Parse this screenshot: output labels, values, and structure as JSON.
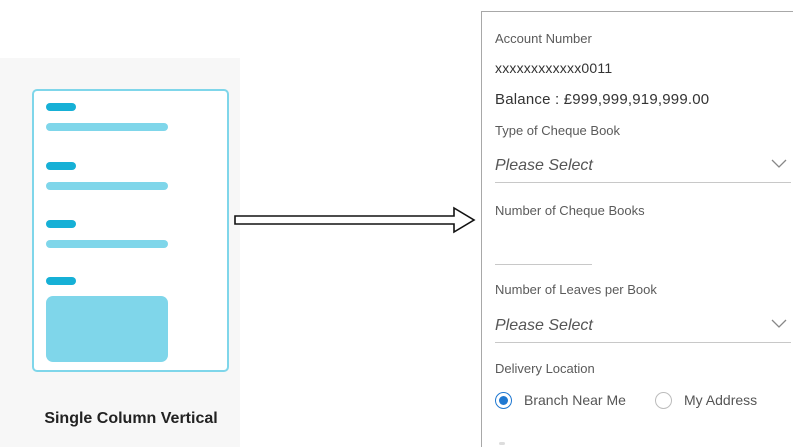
{
  "illustration": {
    "caption": "Single Column Vertical"
  },
  "form": {
    "account_number_label": "Account Number",
    "account_number_value": "xxxxxxxxxxxx0011",
    "balance_text": "Balance : £999,999,919,999.00",
    "cheque_book_type": {
      "label": "Type of Cheque Book",
      "value": "Please Select"
    },
    "cheque_book_count": {
      "label": "Number of Cheque Books",
      "value": ""
    },
    "leaves_per_book": {
      "label": "Number of Leaves per Book",
      "value": "Please Select"
    },
    "delivery_location": {
      "label": "Delivery Location",
      "options": [
        {
          "label": "Branch Near Me",
          "selected": true
        },
        {
          "label": "My Address",
          "selected": false
        }
      ]
    }
  },
  "colors": {
    "wire_accent": "#16b0d6",
    "wire_light": "#7fd6ea",
    "radio_selected": "#1f78d1"
  },
  "icons": [
    "arrow-right-icon",
    "chevron-down-icon"
  ]
}
